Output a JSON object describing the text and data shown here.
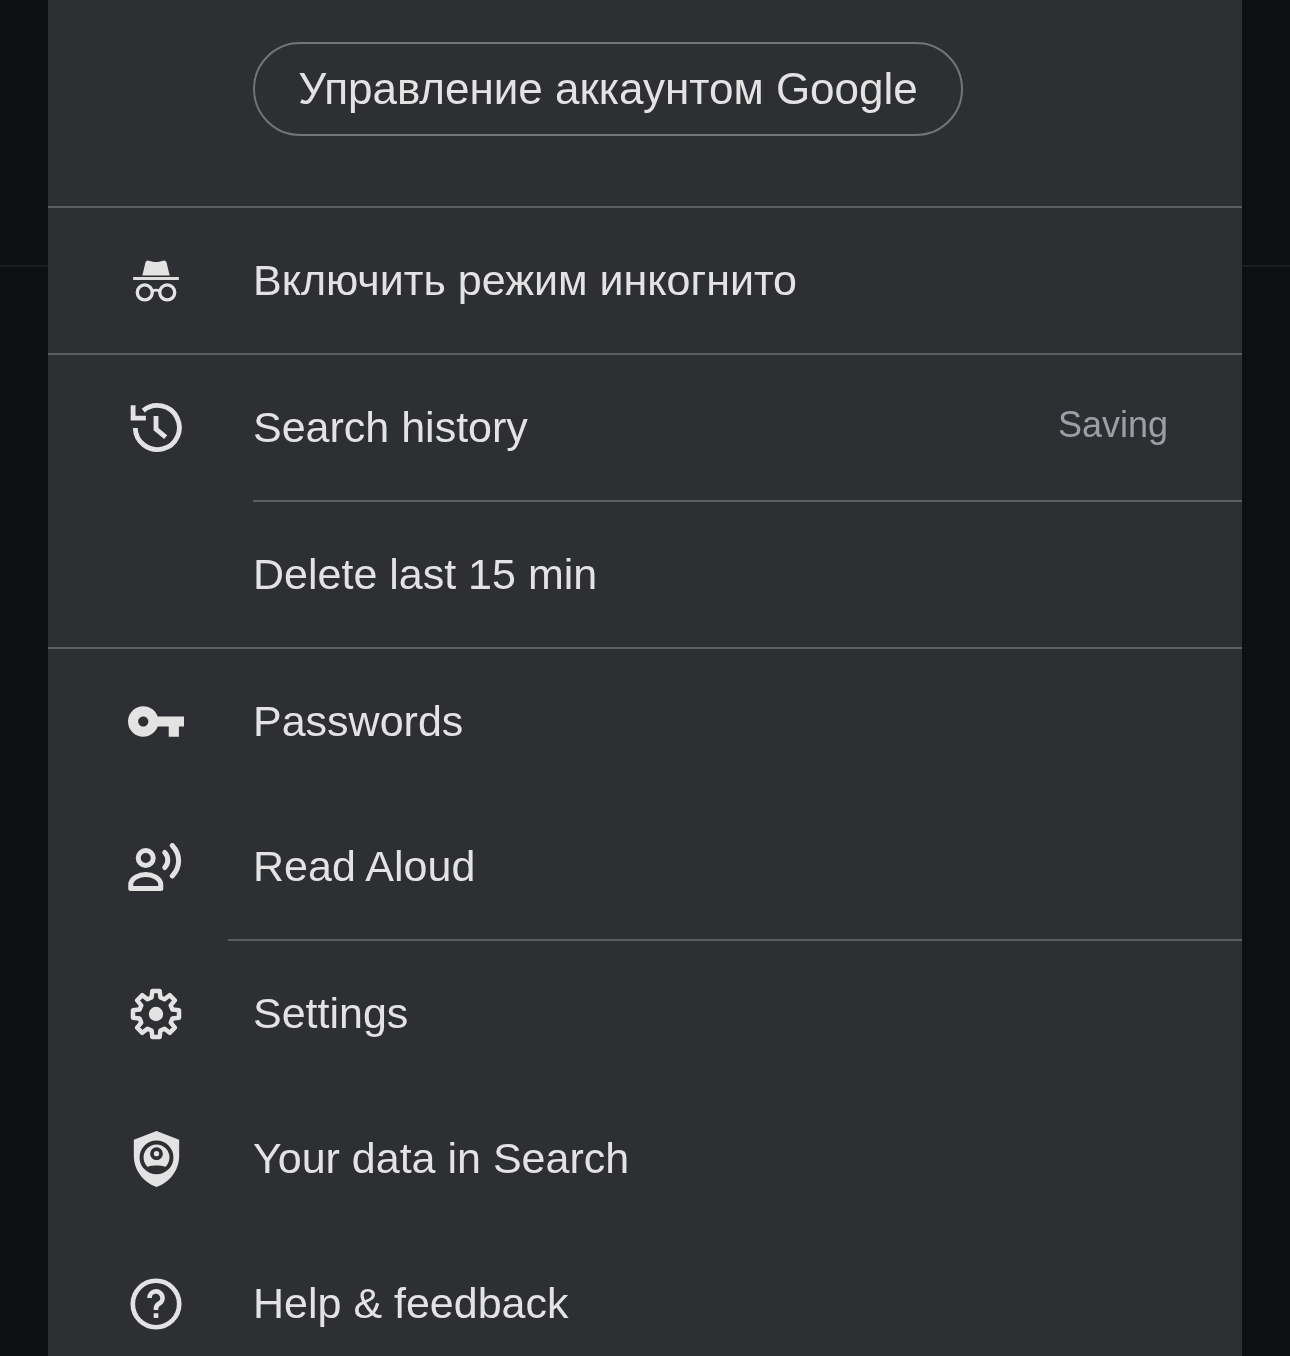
{
  "account_button": {
    "label": "Управление аккаунтом Google"
  },
  "sections": [
    {
      "kind": "primary",
      "items": [
        {
          "kind": "item",
          "label": "Включить режим инкогнито"
        }
      ]
    },
    {
      "kind": "primary",
      "items": [
        {
          "kind": "item",
          "label": "Search history",
          "status": "Saving"
        },
        {
          "kind": "subitem",
          "label": "Delete last 15 min"
        }
      ]
    },
    {
      "kind": "primary",
      "items": [
        {
          "kind": "item",
          "label": "Passwords"
        },
        {
          "kind": "item",
          "label": "Read Aloud"
        }
      ]
    },
    {
      "kind": "secondary",
      "items": [
        {
          "kind": "item",
          "label": "Settings"
        },
        {
          "kind": "item",
          "label": "Your data in Search"
        },
        {
          "kind": "item",
          "label": "Help & feedback"
        }
      ]
    }
  ]
}
